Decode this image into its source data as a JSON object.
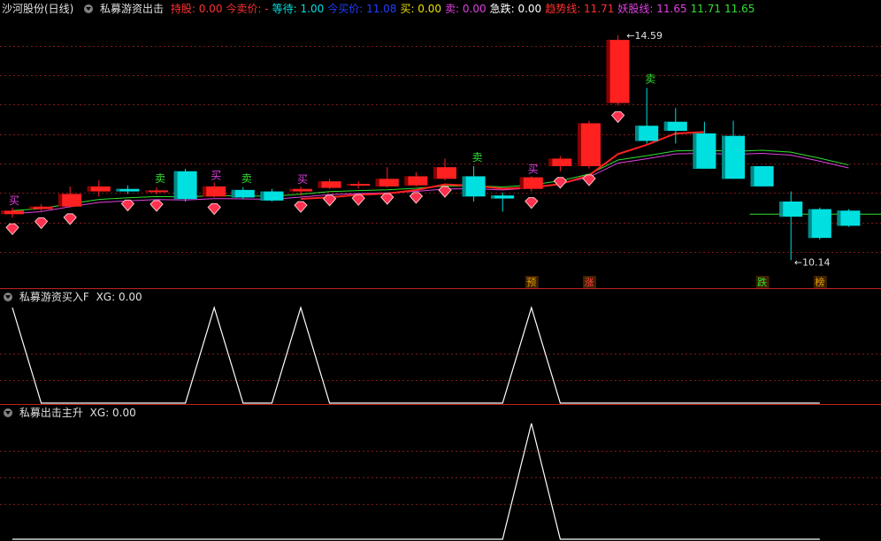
{
  "header": {
    "stock_title": "沙河股份(日线)",
    "indicator_name": "私募游资出击",
    "fields": [
      {
        "label": "持股:",
        "value": "0.00",
        "color": "#ff3030"
      },
      {
        "label": "今卖价:",
        "value": "-",
        "color": "#ff3030"
      },
      {
        "label": "等待:",
        "value": "1.00",
        "color": "#00e0e0"
      },
      {
        "label": "今买价:",
        "value": "11.08",
        "color": "#2040ff"
      },
      {
        "label": "买:",
        "value": "0.00",
        "color": "#e8e000"
      },
      {
        "label": "卖:",
        "value": "0.00",
        "color": "#e040e0"
      },
      {
        "label": "急跌:",
        "value": "0.00",
        "color": "#ffffff"
      },
      {
        "label": "趋势线:",
        "value": "11.71",
        "color": "#ff3030"
      },
      {
        "label": "妖股线:",
        "value": "11.65",
        "color": "#e040e0"
      },
      {
        "label": "",
        "value": "11.71",
        "color": "#30e030"
      },
      {
        "label": "",
        "value": "11.65",
        "color": "#30e030"
      }
    ]
  },
  "panel2": {
    "title": "私募游资买入F",
    "field": "XG: 0.00"
  },
  "panel3": {
    "title": "私募出击主升",
    "field": "XG: 0.00"
  },
  "price_labels": {
    "high": "14.59",
    "low": "10.14"
  },
  "markers": {
    "buy": "买",
    "sell": "卖"
  },
  "event_tags": [
    {
      "text": "预",
      "color": "#e0a000"
    },
    {
      "text": "涨",
      "color": "#ff4040"
    },
    {
      "text": "跌",
      "color": "#30e030"
    },
    {
      "text": "榜",
      "color": "#e0a000"
    }
  ],
  "colors": {
    "up": "#ff2020",
    "down": "#00e0e0",
    "grid": "#801818",
    "trend": "#ff2020",
    "demon": "#e040e0",
    "green": "#30e030"
  },
  "chart_data": {
    "type": "candlestick",
    "price_range": [
      9.9,
      14.8
    ],
    "candles": [
      {
        "o": 11.05,
        "c": 11.12,
        "h": 11.18,
        "l": 10.98
      },
      {
        "o": 11.15,
        "c": 11.2,
        "h": 11.25,
        "l": 11.1
      },
      {
        "o": 11.2,
        "c": 11.45,
        "h": 11.6,
        "l": 11.18
      },
      {
        "o": 11.5,
        "c": 11.6,
        "h": 11.72,
        "l": 11.4
      },
      {
        "o": 11.55,
        "c": 11.5,
        "h": 11.62,
        "l": 11.45
      },
      {
        "o": 11.5,
        "c": 11.52,
        "h": 11.58,
        "l": 11.44
      },
      {
        "o": 11.9,
        "c": 11.35,
        "h": 11.95,
        "l": 11.3
      },
      {
        "o": 11.4,
        "c": 11.6,
        "h": 11.68,
        "l": 11.38
      },
      {
        "o": 11.53,
        "c": 11.38,
        "h": 11.58,
        "l": 11.35
      },
      {
        "o": 11.5,
        "c": 11.32,
        "h": 11.55,
        "l": 11.3
      },
      {
        "o": 11.5,
        "c": 11.55,
        "h": 11.6,
        "l": 11.42
      },
      {
        "o": 11.57,
        "c": 11.7,
        "h": 11.75,
        "l": 11.55
      },
      {
        "o": 11.62,
        "c": 11.65,
        "h": 11.7,
        "l": 11.56
      },
      {
        "o": 11.6,
        "c": 11.75,
        "h": 11.98,
        "l": 11.58
      },
      {
        "o": 11.62,
        "c": 11.8,
        "h": 11.88,
        "l": 11.6
      },
      {
        "o": 11.75,
        "c": 11.98,
        "h": 12.15,
        "l": 11.72
      },
      {
        "o": 11.8,
        "c": 11.4,
        "h": 12.0,
        "l": 11.3
      },
      {
        "o": 11.42,
        "c": 11.36,
        "h": 11.48,
        "l": 11.1
      },
      {
        "o": 11.55,
        "c": 11.78,
        "h": 11.8,
        "l": 11.5
      },
      {
        "o": 12.0,
        "c": 12.15,
        "h": 12.2,
        "l": 11.9
      },
      {
        "o": 12.0,
        "c": 12.85,
        "h": 12.9,
        "l": 11.95
      },
      {
        "o": 13.25,
        "c": 14.5,
        "h": 14.59,
        "l": 13.2
      },
      {
        "o": 12.8,
        "c": 12.5,
        "h": 13.55,
        "l": 12.45
      },
      {
        "o": 12.88,
        "c": 12.7,
        "h": 13.15,
        "l": 12.45
      },
      {
        "o": 12.65,
        "c": 11.95,
        "h": 12.88,
        "l": 11.95
      },
      {
        "o": 12.6,
        "c": 11.75,
        "h": 12.9,
        "l": 11.75
      },
      {
        "o": 12.0,
        "c": 11.6,
        "h": 12.0,
        "l": 11.6
      },
      {
        "o": 11.3,
        "c": 11.0,
        "h": 11.5,
        "l": 10.14
      },
      {
        "o": 11.15,
        "c": 10.58,
        "h": 11.18,
        "l": 10.55
      },
      {
        "o": 11.12,
        "c": 10.82,
        "h": 11.15,
        "l": 10.8
      }
    ],
    "panel2_series": [
      1,
      0,
      0,
      0,
      0,
      0,
      0,
      1,
      0,
      0,
      1,
      0,
      0,
      0,
      0,
      0,
      0,
      0,
      1,
      0,
      0,
      0,
      0,
      0,
      0,
      0,
      0,
      0,
      0
    ],
    "panel3_series": [
      0,
      0,
      0,
      0,
      0,
      0,
      0,
      0,
      0,
      0,
      0,
      0,
      0,
      0,
      0,
      0,
      0,
      0,
      1,
      0,
      0,
      0,
      0,
      0,
      0,
      0,
      0,
      0,
      0
    ]
  }
}
